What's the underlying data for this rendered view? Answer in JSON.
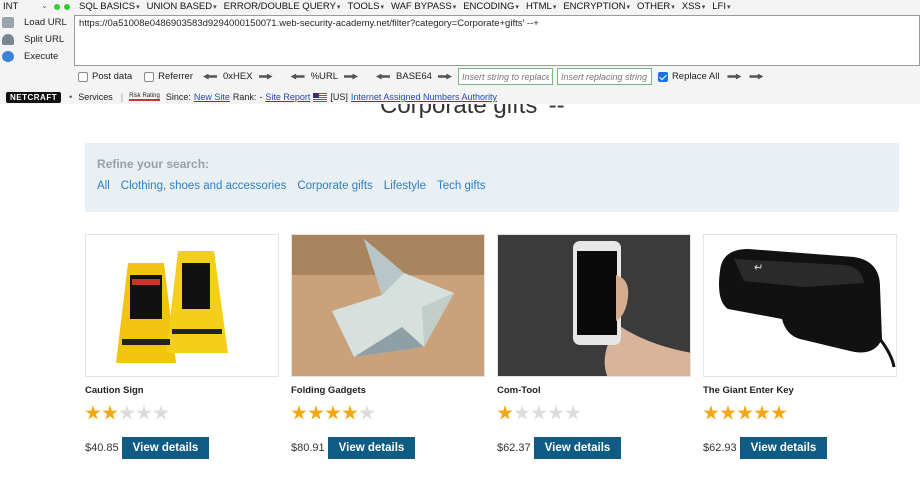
{
  "hackbar": {
    "version_select": "INT",
    "menu": [
      "SQL BASICS",
      "UNION BASED",
      "ERROR/DOUBLE QUERY",
      "TOOLS",
      "WAF BYPASS",
      "ENCODING",
      "HTML",
      "ENCRYPTION",
      "OTHER",
      "XSS",
      "LFI"
    ],
    "load_url": "Load URL",
    "split_url": "Split URL",
    "execute": "Execute",
    "url": "https://0a51008e0486903583d9294000150071.web-security-academy.net/filter?category=Corporate+gifts' --+",
    "post_data": "Post data",
    "referrer": "Referrer",
    "hex": "0xHEX",
    "urlenc": "%URL",
    "base64": "BASE64",
    "insert_placeholder": "Insert string to replace",
    "replace_placeholder": "Insert replacing string",
    "replace_all": "Replace All"
  },
  "netcraft": {
    "logo": "NETCRAFT",
    "services": "Services",
    "risk": "Risk Rating",
    "since_label": "Since:",
    "since_value": "New Site",
    "rank_label": "Rank:",
    "rank_value": "-",
    "site_report": "Site Report",
    "country": "[US]",
    "host": "Internet Assigned Numbers Authority"
  },
  "page": {
    "heading": "Corporate gifts' --",
    "refine_title": "Refine your search:",
    "filters": [
      "All",
      "Clothing, shoes and accessories",
      "Corporate gifts",
      "Lifestyle",
      "Tech gifts"
    ]
  },
  "products": [
    {
      "name": "Caution Sign",
      "rating": 2,
      "price": "$40.85",
      "button": "View details"
    },
    {
      "name": "Folding Gadgets",
      "rating": 4,
      "price": "$80.91",
      "button": "View details"
    },
    {
      "name": "Com-Tool",
      "rating": 1,
      "price": "$62.37",
      "button": "View details"
    },
    {
      "name": "The Giant Enter Key",
      "rating": 5,
      "price": "$62.93",
      "button": "View details"
    }
  ]
}
